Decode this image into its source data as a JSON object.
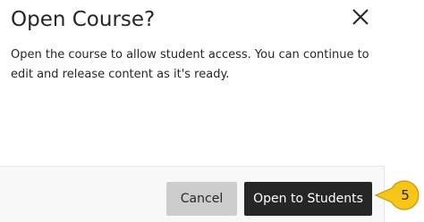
{
  "dialog": {
    "title": "Open Course?",
    "message": "Open the course to allow student access. You can continue to edit and release content as it's ready.",
    "close_icon": "close-icon",
    "buttons": {
      "cancel_label": "Cancel",
      "open_label": "Open to Students"
    }
  },
  "callout": {
    "step_number": "5",
    "fill_color": "#f5c518",
    "border_color": "#c99a00"
  },
  "colors": {
    "primary_button": "#262626",
    "secondary_button": "#cdcdcd",
    "footer_background": "#f8f8f8"
  }
}
